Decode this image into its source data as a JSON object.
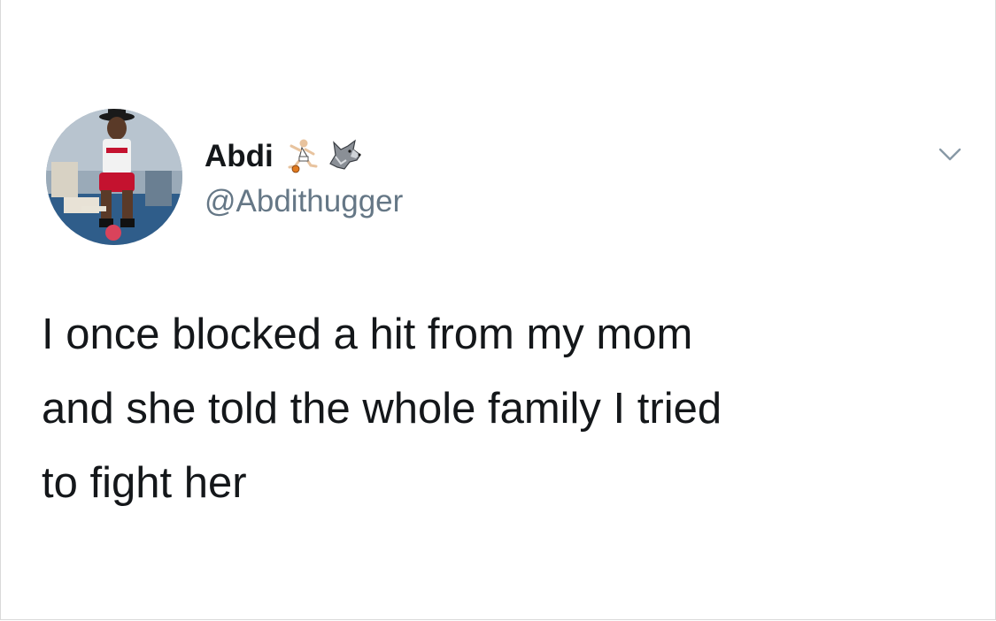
{
  "tweet": {
    "author": {
      "display_name": "Abdi",
      "handle": "@Abdithugger",
      "badges": [
        "basketball-player-icon",
        "wolf-icon"
      ]
    },
    "lines": [
      "I once blocked a hit from my mom",
      "and she told the whole family I tried",
      "to fight her"
    ],
    "menu_icon": "chevron-down-icon"
  },
  "colors": {
    "text_primary": "#14171a",
    "text_secondary": "#657786",
    "chevron": "#8899a6",
    "background": "#ffffff"
  }
}
